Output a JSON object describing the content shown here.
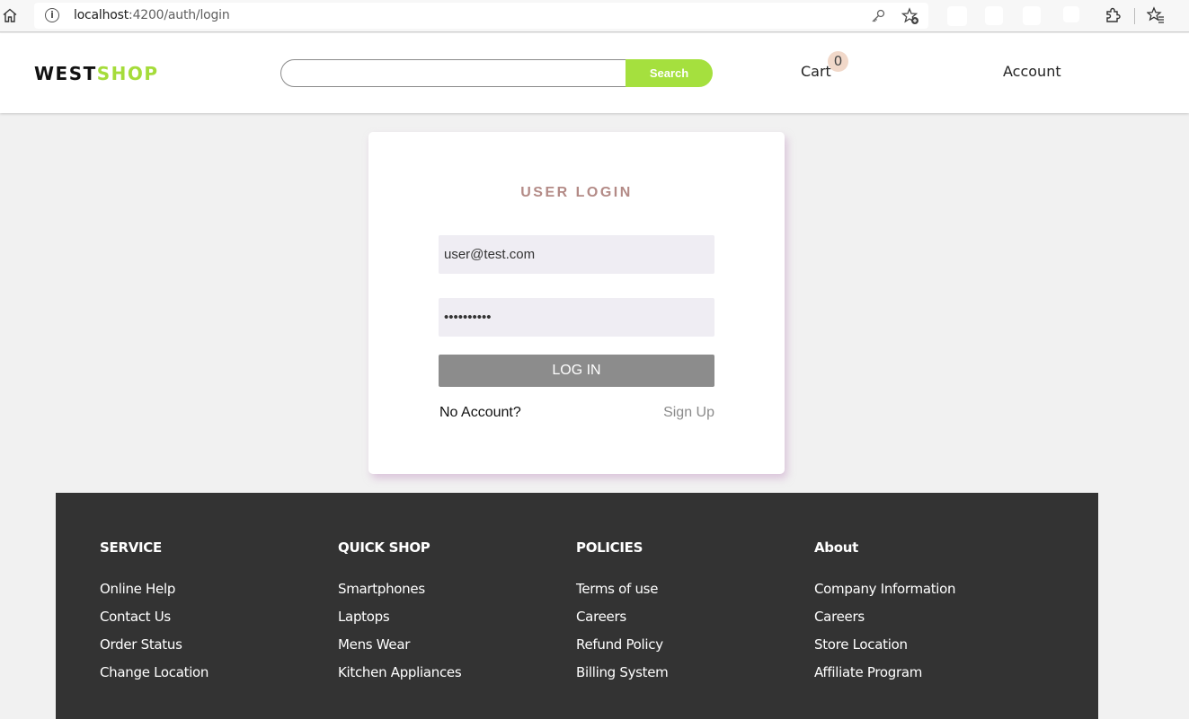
{
  "browser": {
    "url_host": "localhost",
    "url_path": ":4200/auth/login",
    "icons": [
      "home-icon",
      "info-icon",
      "key-icon",
      "add-favorite-icon",
      "extensions-icon",
      "favorites-icon"
    ]
  },
  "header": {
    "logo_west": "WEST",
    "logo_shop": "SHOP",
    "search_placeholder": "",
    "search_label": "Search",
    "cart_label": "Cart",
    "cart_count": "0",
    "account_label": "Account"
  },
  "login": {
    "title": "USER LOGIN",
    "email_value": "user@test.com",
    "password_value": "••••••••••",
    "login_label": "LOG IN",
    "no_account_text": "No Account?",
    "signup_label": "Sign Up"
  },
  "footer": {
    "columns": [
      {
        "heading": "SERVICE",
        "links": [
          "Online Help",
          "Contact Us",
          "Order Status",
          "Change Location"
        ]
      },
      {
        "heading": "QUICK SHOP",
        "links": [
          "Smartphones",
          "Laptops",
          "Mens Wear",
          "Kitchen Appliances"
        ]
      },
      {
        "heading": "POLICIES",
        "links": [
          "Terms of use",
          "Careers",
          "Refund Policy",
          "Billing System"
        ]
      },
      {
        "heading": "About",
        "links": [
          "Company Information",
          "Careers",
          "Store Location",
          "Affiliate Program"
        ]
      }
    ]
  },
  "colors": {
    "accent_green": "#a5e03e",
    "title_rose": "#b38a86",
    "footer_bg": "#333333",
    "login_button": "#8c8c8c"
  }
}
